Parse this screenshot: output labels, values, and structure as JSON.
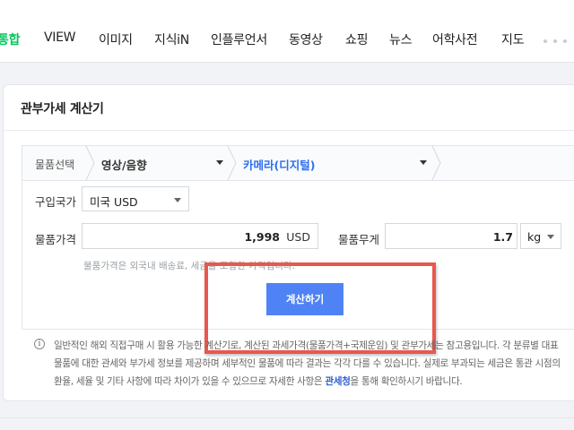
{
  "tabs": [
    {
      "label": "통합",
      "active": true
    },
    {
      "label": "VIEW"
    },
    {
      "label": "이미지"
    },
    {
      "label": "지식iN"
    },
    {
      "label": "인플루언서"
    },
    {
      "label": "동영상"
    },
    {
      "label": "쇼핑"
    },
    {
      "label": "뉴스"
    },
    {
      "label": "어학사전"
    },
    {
      "label": "지도"
    }
  ],
  "card": {
    "title": "관부가세 계산기"
  },
  "path": {
    "root": "물품선택",
    "category": "영상/음향",
    "subcategory": "카메라(디지털)"
  },
  "form": {
    "country_label": "구입국가",
    "country_value": "미국 USD",
    "price_label": "물품가격",
    "price_value": "1,998",
    "price_unit": "USD",
    "weight_label": "물품무게",
    "weight_value": "1.7",
    "weight_unit": "kg",
    "price_note": "물품가격은 외국내 배송료, 세금을 포함한 가격입니다.",
    "calculate_label": "계산하기"
  },
  "info": {
    "text_before": "일반적인 해외 직접구매 시 활용 가능한 계산기로, 계산된 과세가격(물품가격+국제운임) 및 관부가세는 참고용입니다. 각 분류별 대표 물품에 대한 관세와 부가세 정보를 제공하며 세부적인 물품에 따라 결과는 각각 다를 수 있습니다. 실제로 부과되는 세금은 통관 시점의 환율, 세율 및 기타 사항에 따라 차이가 있을 수 있으므로 자세한 사항은 ",
    "link": "관세청",
    "text_after": "을 통해 확인하시기 바랍니다."
  },
  "colors": {
    "active_tab": "#03c75a",
    "button": "#4f83f5",
    "highlight": "#e8584e",
    "link": "#2e5fd1"
  }
}
